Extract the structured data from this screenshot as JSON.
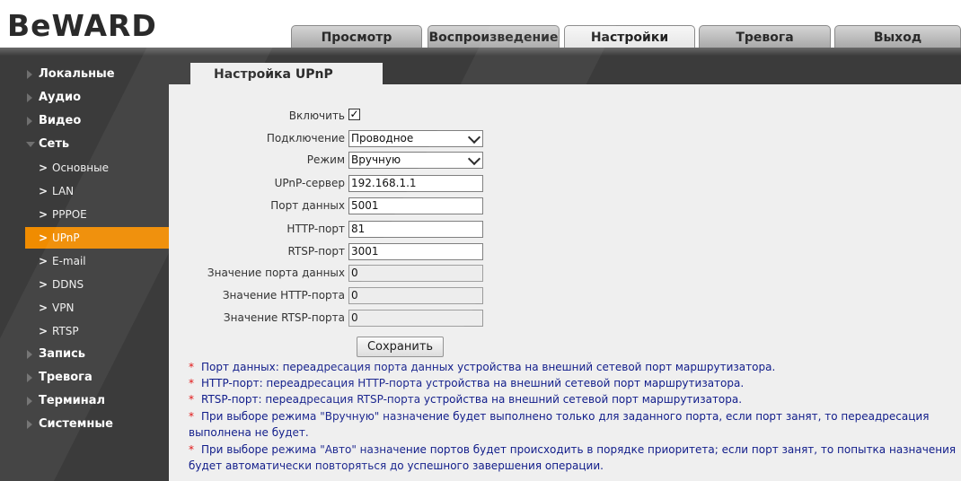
{
  "logo": "BeWARD",
  "nav": {
    "tabs": [
      {
        "label": "Просмотр",
        "active": false
      },
      {
        "label": "Воспроизведение",
        "active": false
      },
      {
        "label": "Настройки",
        "active": true
      },
      {
        "label": "Тревога",
        "active": false
      },
      {
        "label": "Выход",
        "active": false
      }
    ]
  },
  "sidebar": {
    "items": [
      {
        "label": "Локальные",
        "type": "top",
        "expanded": false
      },
      {
        "label": "Аудио",
        "type": "top",
        "expanded": false
      },
      {
        "label": "Видео",
        "type": "top",
        "expanded": false
      },
      {
        "label": "Сеть",
        "type": "top",
        "expanded": true
      },
      {
        "label": "Основные",
        "type": "sub"
      },
      {
        "label": "LAN",
        "type": "sub"
      },
      {
        "label": "PPPOE",
        "type": "sub"
      },
      {
        "label": "UPnP",
        "type": "sub",
        "active": true
      },
      {
        "label": "E-mail",
        "type": "sub"
      },
      {
        "label": "DDNS",
        "type": "sub"
      },
      {
        "label": "VPN",
        "type": "sub"
      },
      {
        "label": "RTSP",
        "type": "sub"
      },
      {
        "label": "Запись",
        "type": "top",
        "expanded": false
      },
      {
        "label": "Тревога",
        "type": "top",
        "expanded": false
      },
      {
        "label": "Терминал",
        "type": "top",
        "expanded": false
      },
      {
        "label": "Системные",
        "type": "top",
        "expanded": false
      }
    ],
    "chevron": ">"
  },
  "section": {
    "title": "Настройка UPnP"
  },
  "form": {
    "enable": {
      "label": "Включить",
      "checked": true,
      "mark": "✓"
    },
    "connection": {
      "label": "Подключение",
      "value": "Проводное"
    },
    "mode": {
      "label": "Режим",
      "value": "Вручную"
    },
    "upnp_server": {
      "label": "UPnP-сервер",
      "value": "192.168.1.1"
    },
    "data_port": {
      "label": "Порт данных",
      "value": "5001"
    },
    "http_port": {
      "label": "HTTP-порт",
      "value": "81"
    },
    "rtsp_port": {
      "label": "RTSP-порт",
      "value": "3001"
    },
    "data_port_value": {
      "label": "Значение порта данных",
      "value": "0"
    },
    "http_port_value": {
      "label": "Значение HTTP-порта",
      "value": "0"
    },
    "rtsp_port_value": {
      "label": "Значение RTSP-порта",
      "value": "0"
    },
    "save_label": "Сохранить"
  },
  "notes": {
    "asterisk": "*",
    "items": [
      "Порт данных: переадресация порта данных устройства на внешний сетевой порт маршрутизатора.",
      "HTTP-порт: переадресация HTTP-порта устройства на внешний сетевой порт маршрутизатора.",
      "RTSP-порт: переадресация RTSP-порта устройства на внешний сетевой порт маршрутизатора.",
      "При выборе режима \"Вручную\" назначение будет выполнено только для заданного порта, если порт занят, то переадресация выполнена не будет.",
      "При выборе режима \"Авто\" назначение портов будет происходить в порядке приоритета; если порт занят, то попытка назначения будет автоматически повторяться до успешного завершения операции."
    ]
  },
  "colors": {
    "sidebar_bg": "#3b3b3b",
    "active_item": "#f08c00",
    "content_bg": "#efefef",
    "note_text": "#101c8a",
    "asterisk": "#e11414"
  }
}
